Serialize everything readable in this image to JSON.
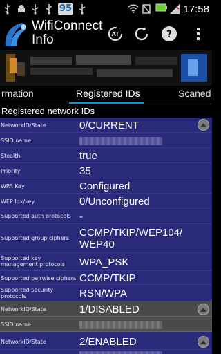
{
  "statusbar": {
    "badge": "95",
    "time": "17:58",
    "icons": [
      "usb-icon",
      "android-icon",
      "usb-icon",
      "usb-icon",
      "usb-icon",
      "wifi-icon",
      "no-sim-icon",
      "battery-icon",
      "signal-icon"
    ]
  },
  "app": {
    "title_line1": "WifiConnect",
    "title_line2": "Info"
  },
  "header_buttons": [
    "auto-refresh",
    "refresh",
    "help",
    "overflow-menu"
  ],
  "tabs": [
    "rmation",
    "Registered IDs",
    "Scaned"
  ],
  "section_title": "Registered network IDs",
  "network1": {
    "rows": [
      {
        "label": "NetworkID/State",
        "value": "0/CURRENT"
      },
      {
        "label": "SSID name",
        "value": ""
      },
      {
        "label": "Stealth",
        "value": "true"
      },
      {
        "label": "Priority",
        "value": "35"
      },
      {
        "label": "WPA Key",
        "value": "Configured"
      },
      {
        "label": "WEP Idx/key",
        "value": "0/Unconfigured"
      },
      {
        "label": "Supported auth protocols",
        "value": "-"
      },
      {
        "label": "Supported group ciphers",
        "value": "CCMP/TKIP/WEP104/\nWEP40"
      },
      {
        "label": "Supported key management protocols",
        "value": "WPA_PSK"
      },
      {
        "label": "Supported pairwise ciphers",
        "value": "CCMP/TKIP"
      },
      {
        "label": "Supported security protocols",
        "value": "RSN/WPA"
      }
    ]
  },
  "network2": {
    "rows": [
      {
        "label": "NetworkID/State",
        "value": "1/DISABLED"
      },
      {
        "label": "SSID name",
        "value": ""
      }
    ]
  },
  "network3": {
    "rows": [
      {
        "label": "NetworkID/State",
        "value": "2/ENABLED"
      }
    ]
  },
  "colors": {
    "row_bg": "#2a2a7a",
    "disabled_bg": "#4a4a4a",
    "tab_accent": "#1e90d8"
  }
}
